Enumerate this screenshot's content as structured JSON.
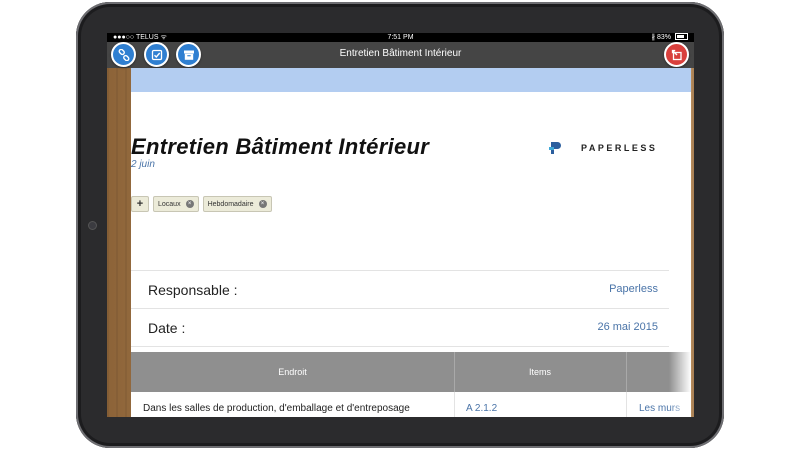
{
  "status_bar": {
    "carrier": "●●●○○ TELUS ᯤ",
    "time": "7:51 PM",
    "battery": "∦ 83%",
    "battery_fill": 0.83
  },
  "nav": {
    "title": "Entretien Bâtiment Intérieur",
    "buttons": {
      "link_icon": "link-icon",
      "check_icon": "checkbox-icon",
      "archive_icon": "archive-icon",
      "exit_icon": "exit-icon"
    }
  },
  "colors": {
    "button_blue": "#2f7fd1",
    "button_red": "#d9403d",
    "header_band": "#b3cdf1",
    "link_blue": "#4a74a8",
    "table_header": "#8f8f8f"
  },
  "document": {
    "title": "Entretien Bâtiment Intérieur",
    "date": "2 juin",
    "logo_text": "PAPERLESS",
    "tags": {
      "add": "+",
      "items": [
        "Locaux",
        "Hebdomadaire"
      ],
      "remove_glyph": "×"
    },
    "fields": [
      {
        "label": "Responsable :",
        "value": "Paperless"
      },
      {
        "label": "Date :",
        "value": "26 mai 2015"
      }
    ],
    "table": {
      "headers": [
        "Endroit",
        "Items"
      ],
      "rows": [
        {
          "endroit": "Dans les salles de production, d'emballage et d'entreposage",
          "items": "A 2.1.2",
          "extra": "Les murs"
        }
      ]
    }
  }
}
